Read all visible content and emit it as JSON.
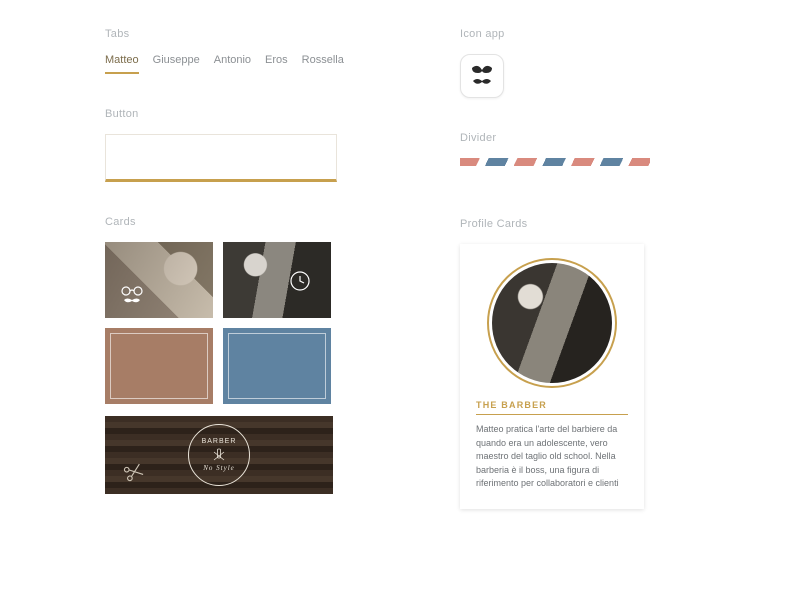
{
  "sections": {
    "tabs": "Tabs",
    "button": "Button",
    "cards": "Cards",
    "icon_app": "Icon app",
    "divider": "Divider",
    "profile_cards": "Profile Cards"
  },
  "tabs": {
    "items": [
      {
        "label": "Matteo",
        "active": true
      },
      {
        "label": "Giuseppe",
        "active": false
      },
      {
        "label": "Antonio",
        "active": false
      },
      {
        "label": "Eros",
        "active": false
      },
      {
        "label": "Rossella",
        "active": false
      }
    ]
  },
  "cards": {
    "badge_top": "BARBER",
    "badge_bottom": "No Style"
  },
  "profile": {
    "title": "THE BARBER",
    "body": "Matteo pratica l'arte del barbiere da quando era un adolescente, vero maestro del taglio old school. Nella barberia è il boss, una figura di riferimento per collaboratori e clienti"
  },
  "colors": {
    "accent": "#c7a04e",
    "brown": "#a77d66",
    "blue": "#5f83a1",
    "coral": "#d98a7e"
  }
}
